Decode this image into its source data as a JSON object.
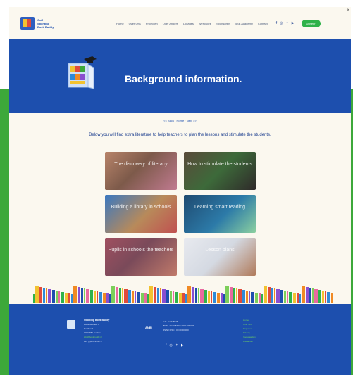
{
  "header": {
    "logo_text": "Gulf Stichting Boek Buddy",
    "nav": [
      "Home",
      "Over Ons",
      "Projecten",
      "Over Anders",
      "Locaties",
      "Werkwijze",
      "Sponsoren",
      "BBB Academy",
      "Contact"
    ],
    "social_icons": [
      "facebook-icon",
      "instagram-icon",
      "twitter-icon",
      "youtube-icon"
    ],
    "donate_label": "Doneer",
    "close_label": "×"
  },
  "hero": {
    "title": "Background information."
  },
  "content": {
    "breadcrumbs": "<< Back · Home · Next >>",
    "intro": "Below you will find extra literature to help teachers to plan the lessons and stimulate the students.",
    "tiles": [
      {
        "label": "The discovery of literacy"
      },
      {
        "label": "How to stimulate the students"
      },
      {
        "label": "Building a library in schools"
      },
      {
        "label": "Learning smart reading"
      },
      {
        "label": "Pupils in schools the teachers"
      },
      {
        "label": "Lesson plans"
      }
    ]
  },
  "footer": {
    "org_name": "Stichting Boek Buddy",
    "address_lines": [
      "Lotus Gebouw 6",
      "Postbus 1",
      "0000 AB Leusden"
    ],
    "email": "info@bookbuddy.nl",
    "phone": "+31 (0)6 12345678",
    "anbi": "ANBI",
    "info_lines": [
      "KvK · 12345678",
      "IBAN · NL00 BANK 0000 0000 00",
      "RSIN / FISC · 00 00 00 000"
    ],
    "social_icons": [
      "facebook-icon",
      "instagram-icon",
      "twitter-icon",
      "youtube-icon"
    ],
    "links": [
      "Home",
      "Over Ons",
      "Projecten",
      "Privacy",
      "Voorwaarden",
      "Disclaimer"
    ]
  },
  "colors": {
    "primary_blue": "#1d4fae",
    "accent_green": "#3da83a",
    "cream": "#fbf8ef"
  }
}
